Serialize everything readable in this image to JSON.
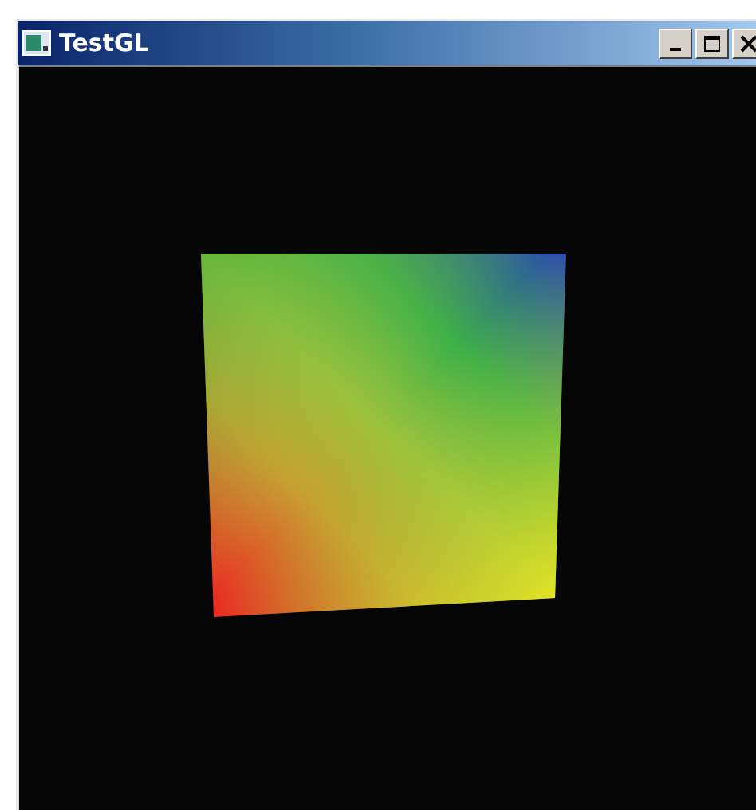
{
  "window": {
    "title": "TestGL"
  }
}
